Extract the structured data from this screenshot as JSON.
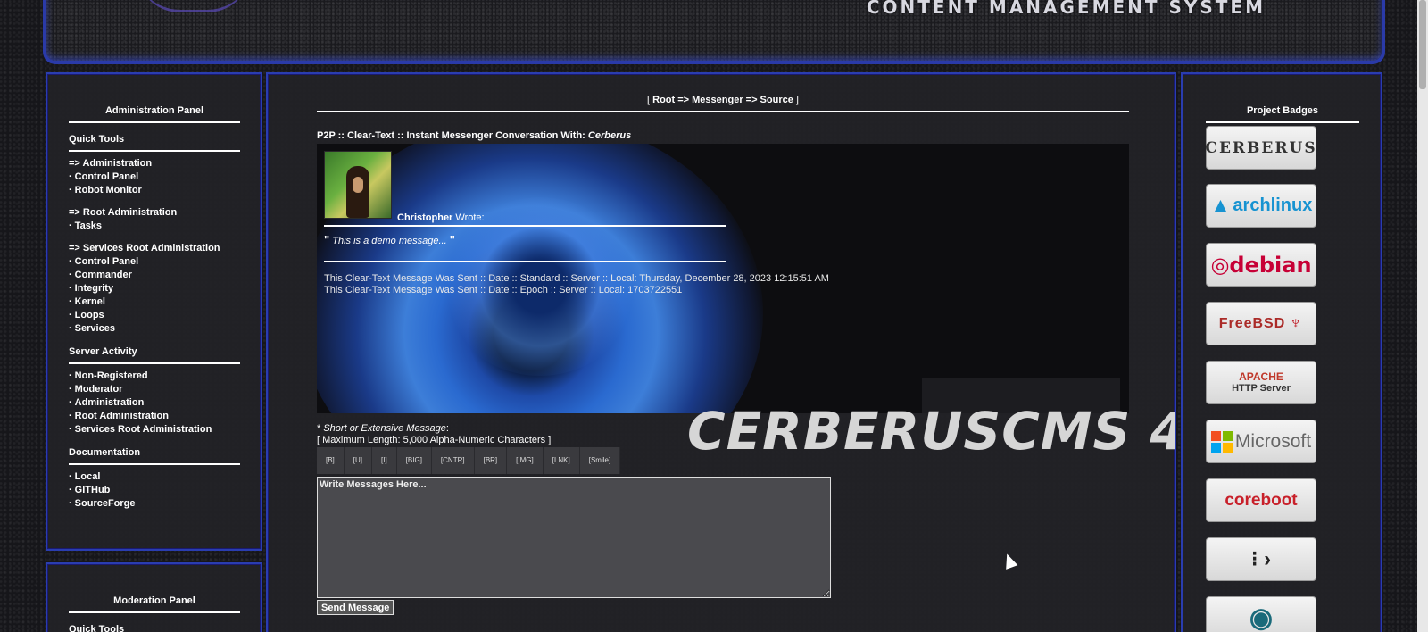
{
  "banner": {
    "text": "CONTENT MANAGEMENT SYSTEM"
  },
  "left_panel": {
    "title": "Administration Panel",
    "quick_tools": {
      "heading": "Quick Tools",
      "groups": [
        {
          "head": "=> Administration",
          "items": [
            "Control Panel",
            "Robot Monitor"
          ]
        },
        {
          "head": "=> Root Administration",
          "items": [
            "Tasks"
          ]
        },
        {
          "head": "=> Services Root Administration",
          "items": [
            "Control Panel",
            "Commander",
            "Integrity",
            "Kernel",
            "Loops",
            "Services"
          ]
        }
      ]
    },
    "server_activity": {
      "heading": "Server Activity",
      "items": [
        "Non-Registered",
        "Moderator",
        "Administration",
        "Root Administration",
        "Services Root Administration"
      ]
    },
    "documentation": {
      "heading": "Documentation",
      "items": [
        "Local",
        "GITHub",
        "SourceForge"
      ]
    },
    "bullet": "·"
  },
  "left_panel2": {
    "title": "Moderation Panel",
    "first_heading": "Quick Tools"
  },
  "center": {
    "breadcrumb": {
      "open": "[ ",
      "path": "Root => Messenger => Source",
      "close": " ]"
    },
    "conversation_title": "P2P :: Clear-Text :: Instant Messenger Conversation With: ",
    "conversation_with": "Cerberus",
    "message": {
      "author": "Christopher",
      "wrote_label": " Wrote:",
      "quote_open": "\"",
      "quote_text": "This is a demo message...",
      "quote_close": "\"",
      "sent_standard": "This Clear-Text Message Was Sent :: Date :: Standard :: Server :: Local: Thursday, December 28, 2023 12:15:51 AM",
      "sent_epoch": "This Clear-Text Message Was Sent :: Date :: Epoch :: Server :: Local: 1703722551"
    },
    "compose": {
      "required_mark": "* ",
      "short_label": "Short or Extensive Message",
      "short_colon": ":",
      "max_length": "[ Maximum Length: 5,000 Alpha-Numeric Characters ]",
      "toolbar": [
        "[B]",
        "[U]",
        "[I]",
        "[BIG]",
        "[CNTR]",
        "[BR]",
        "[IMG]",
        "[LNK]",
        "[Smile]"
      ],
      "placeholder": "Write Messages Here...",
      "send_label": "Send Message"
    },
    "watermark": "CERBERUSCMS 4"
  },
  "right_panel": {
    "title": "Project Badges",
    "badges": [
      {
        "name": "cerberus",
        "label": "CERBERUS"
      },
      {
        "name": "archlinux",
        "label": "archlinux"
      },
      {
        "name": "debian",
        "label": "debian"
      },
      {
        "name": "freebsd",
        "label": "FreeBSD"
      },
      {
        "name": "apache",
        "label_top": "APACHE",
        "label_bottom": "HTTP Server"
      },
      {
        "name": "microsoft",
        "label": "Microsoft"
      },
      {
        "name": "coreboot",
        "label": "coreboot"
      },
      {
        "name": "next",
        "label": ""
      },
      {
        "name": "last",
        "label": ""
      }
    ]
  },
  "colors": {
    "panel_border": "#2a3db0",
    "panel_bg": "#222226",
    "ms_red": "#f25022",
    "ms_green": "#7fba00",
    "ms_blue": "#00a4ef",
    "ms_yellow": "#ffb900"
  }
}
